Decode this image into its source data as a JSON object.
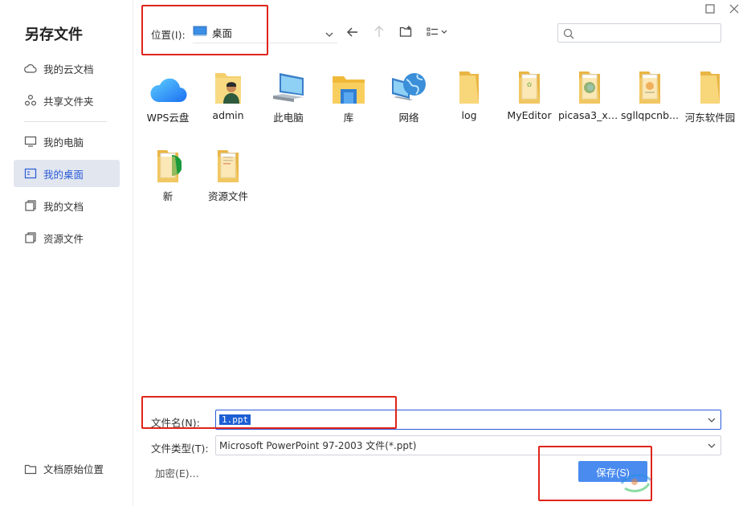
{
  "dialog": {
    "title": "另存文件"
  },
  "sidebar": {
    "items": [
      {
        "label": "我的云文档",
        "icon": "cloud-icon"
      },
      {
        "label": "共享文件夹",
        "icon": "share-icon"
      },
      {
        "label": "我的电脑",
        "icon": "monitor-icon"
      },
      {
        "label": "我的桌面",
        "icon": "desktop-icon",
        "active": true
      },
      {
        "label": "我的文档",
        "icon": "documents-icon"
      },
      {
        "label": "资源文件",
        "icon": "folder-stack-icon"
      }
    ],
    "original_location": "文档原始位置"
  },
  "location": {
    "label": "位置(I):",
    "value": "桌面"
  },
  "search": {
    "placeholder": ""
  },
  "files": [
    {
      "name": "WPS云盘",
      "icon": "wps-cloud-icon"
    },
    {
      "name": "admin",
      "icon": "user-folder-icon"
    },
    {
      "name": "此电脑",
      "icon": "computer-icon"
    },
    {
      "name": "库",
      "icon": "library-icon"
    },
    {
      "name": "网络",
      "icon": "network-icon"
    },
    {
      "name": "log",
      "icon": "folder-icon"
    },
    {
      "name": "MyEditor",
      "icon": "folder-doc-icon"
    },
    {
      "name": "picasa3_xz...",
      "icon": "folder-edge-icon"
    },
    {
      "name": "sgllqpcnb...",
      "icon": "folder-doc-icon"
    },
    {
      "name": "河东软件园",
      "icon": "folder-icon"
    },
    {
      "name": "新",
      "icon": "folder-edge-icon"
    },
    {
      "name": "资源文件",
      "icon": "folder-doc-icon"
    }
  ],
  "filename": {
    "label": "文件名(N):",
    "value": "1.ppt"
  },
  "filetype": {
    "label": "文件类型(T):",
    "value": "Microsoft PowerPoint 97-2003 文件(*.ppt)"
  },
  "buttons": {
    "encrypt": "加密(E)...",
    "save": "保存(S)"
  },
  "colors": {
    "accent": "#4a8bef",
    "selection": "#1c5fd4",
    "annotation": "#e0241b",
    "sidebar_active": "#e1e6ef"
  }
}
